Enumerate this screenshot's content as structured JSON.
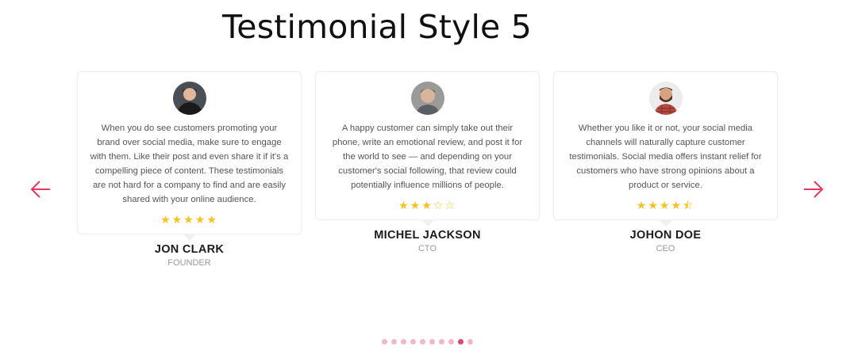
{
  "page": {
    "title": "Testimonial Style 5"
  },
  "nav": {
    "prev_icon": "arrow-left-icon",
    "next_icon": "arrow-right-icon",
    "accent_color": "#e8385f"
  },
  "testimonials": [
    {
      "quote": "When you do see customers promoting your brand over social media, make sure to engage with them. Like their post and even share it if it's a compelling piece of content. These testimonials are not hard for a company to find and are easily shared with your online audience.",
      "rating": 5,
      "stars": "★★★★★",
      "name": "JON CLARK",
      "role": "FOUNDER"
    },
    {
      "quote": "A happy customer can simply take out their phone, write an emotional review, and post it for the world to see — and depending on your customer's social following, that review could potentially influence millions of people.",
      "rating": 3,
      "stars": "★★★☆☆",
      "name": "MICHEL JACKSON",
      "role": "CTO"
    },
    {
      "quote": "Whether you like it or not, your social media channels will naturally capture customer testimonials. Social media offers instant relief for customers who have strong opinions about a product or service.",
      "rating": 4.5,
      "stars": "★★★★⯪",
      "name": "JOHON DOE",
      "role": "CEO"
    }
  ],
  "pagination": {
    "count": 10,
    "active_index": 8
  },
  "colors": {
    "star": "#f6c31c",
    "dot": "#f2b8c8",
    "dot_active": "#e0456f"
  }
}
